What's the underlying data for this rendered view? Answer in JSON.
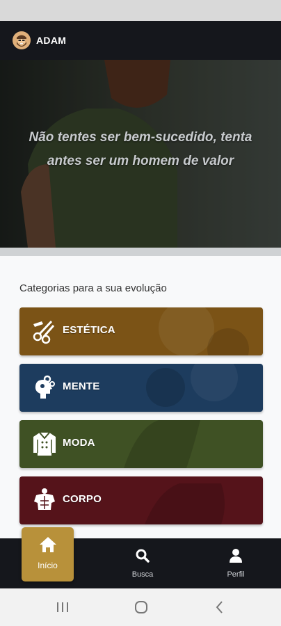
{
  "header": {
    "title": "ADAM",
    "avatar_icon": "bearded-man-avatar-icon"
  },
  "hero": {
    "quote": "Não tentes ser bem-sucedido, tenta antes ser um homem de valor"
  },
  "categories": {
    "title": "Categorias para a sua evolução",
    "items": [
      {
        "label": "ESTÉTICA",
        "icon": "scissors-comb-icon",
        "color": "#7b5316"
      },
      {
        "label": "MENTE",
        "icon": "head-gears-icon",
        "color": "#1d3c5e"
      },
      {
        "label": "MODA",
        "icon": "chef-jacket-icon",
        "color": "#3f5124"
      },
      {
        "label": "CORPO",
        "icon": "muscle-torso-icon",
        "color": "#55131a"
      }
    ]
  },
  "bottom_nav": {
    "items": [
      {
        "label": "Início",
        "icon": "home-icon",
        "active": true
      },
      {
        "label": "Busca",
        "icon": "search-icon",
        "active": false
      },
      {
        "label": "Perfil",
        "icon": "user-icon",
        "active": false
      }
    ],
    "active_color": "#b8913a"
  },
  "system_nav": {
    "buttons": [
      "recent-apps-icon",
      "home-circle-icon",
      "back-chevron-icon"
    ]
  }
}
